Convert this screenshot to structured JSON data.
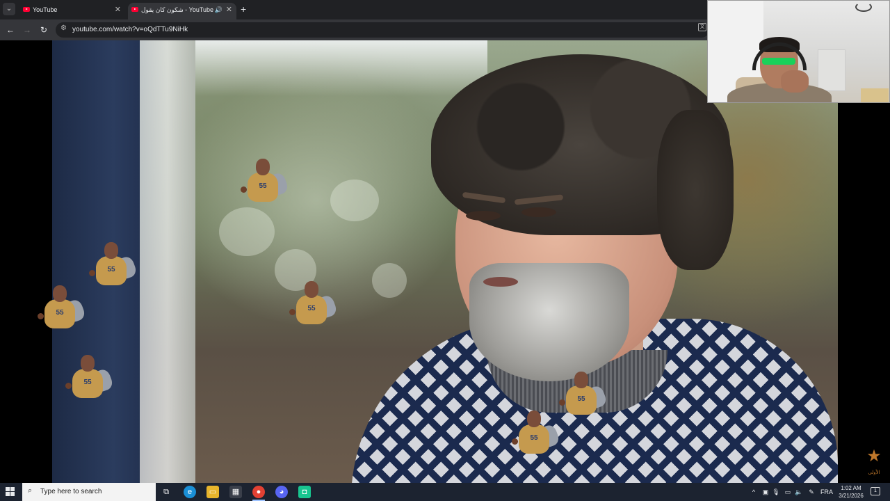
{
  "browser": {
    "tabs": [
      {
        "title": "YouTube",
        "active": false
      },
      {
        "title": "شكون كان يقول - YouTube",
        "active": true
      }
    ],
    "new_tab_symbol": "+",
    "close_symbol": "✕",
    "address": "youtube.com/watch?v=oQdTTu9NiHk"
  },
  "video": {
    "sticker_number": "55",
    "watermark_text": "الأولى"
  },
  "taskbar": {
    "search_placeholder": "Type here to search",
    "language": "FRA",
    "time": "1:02 AM",
    "date": "3/21/2026",
    "notification_count": "1",
    "apps": [
      "task-view",
      "edge",
      "file-explorer",
      "store",
      "chrome",
      "discord",
      "app"
    ]
  },
  "colors": {
    "youtube_red": "#ff0033",
    "taskbar_bg": "#1c2330",
    "chrome_dark": "#202124"
  }
}
